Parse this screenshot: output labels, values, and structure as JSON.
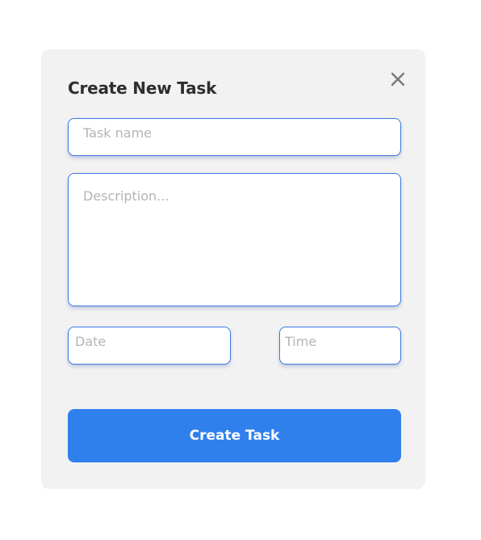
{
  "modal": {
    "title": "Create New Task",
    "close_icon": "close-icon",
    "fields": {
      "task_name": {
        "value": "",
        "placeholder": "Task name"
      },
      "description": {
        "value": "",
        "placeholder": "Description..."
      },
      "date": {
        "value": "",
        "placeholder": "Date"
      },
      "time": {
        "value": "",
        "placeholder": "Time"
      }
    },
    "submit_label": "Create Task"
  },
  "colors": {
    "modal_background": "#f2f2f2",
    "input_border": "#3b78e0",
    "primary_button": "#2f80ed",
    "title_text": "#2e2e2e",
    "placeholder_text": "#b4b4b4",
    "close_icon": "#7a7a7a"
  }
}
